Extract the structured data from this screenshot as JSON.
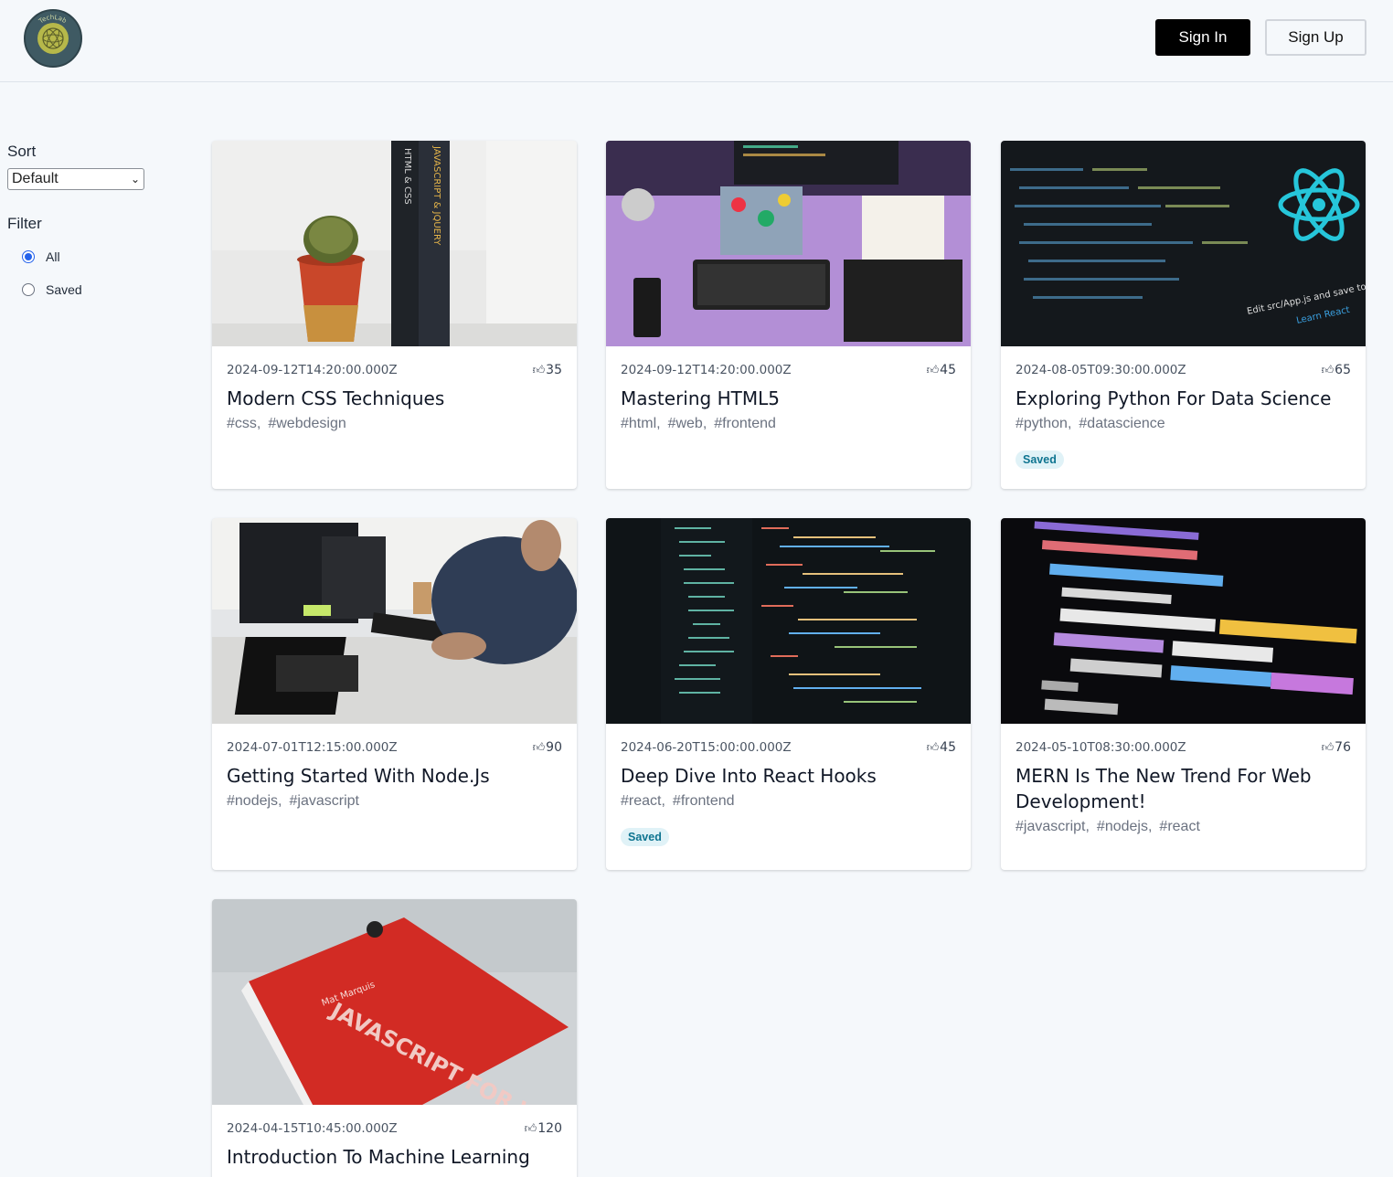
{
  "header": {
    "logo_text": "TechLab",
    "signin_label": "Sign In",
    "signup_label": "Sign Up"
  },
  "sidebar": {
    "sort_heading": "Sort",
    "sort_value": "Default",
    "filter_heading": "Filter",
    "filter_options": [
      {
        "label": "All",
        "checked": true
      },
      {
        "label": "Saved",
        "checked": false
      }
    ]
  },
  "posts": [
    {
      "date": "2024-09-12T14:20:00.000Z",
      "likes": "35",
      "title": "Modern CSS Techniques",
      "tags": [
        "#css,",
        "#webdesign"
      ],
      "saved": false,
      "image": "cactus-books"
    },
    {
      "date": "2024-09-12T14:20:00.000Z",
      "likes": "45",
      "title": "Mastering HTML5",
      "tags": [
        "#html,",
        "#web,",
        "#frontend"
      ],
      "saved": false,
      "image": "desk-setup"
    },
    {
      "date": "2024-08-05T09:30:00.000Z",
      "likes": "65",
      "title": "Exploring Python For Data Science",
      "tags": [
        "#python,",
        "#datascience"
      ],
      "saved": true,
      "image": "react-screen"
    },
    {
      "date": "2024-07-01T12:15:00.000Z",
      "likes": "90",
      "title": "Getting Started With Node.Js",
      "tags": [
        "#nodejs,",
        "#javascript"
      ],
      "saved": false,
      "image": "office-people"
    },
    {
      "date": "2024-06-20T15:00:00.000Z",
      "likes": "45",
      "title": "Deep Dive Into React Hooks",
      "tags": [
        "#react,",
        "#frontend"
      ],
      "saved": true,
      "image": "code-editor"
    },
    {
      "date": "2024-05-10T08:30:00.000Z",
      "likes": "76",
      "title": "MERN Is The New Trend For Web Development!",
      "tags": [
        "#javascript,",
        "#nodejs,",
        "#react"
      ],
      "saved": false,
      "image": "code-colorful"
    },
    {
      "date": "2024-04-15T10:45:00.000Z",
      "likes": "120",
      "title": "Introduction To Machine Learning",
      "tags": [],
      "saved": false,
      "image": "red-book"
    }
  ],
  "saved_badge_label": "Saved",
  "like_icon": "thumbs-up-icon",
  "image_texts": {
    "book_spine_1": "HTML & CSS",
    "book_spine_2": "JAVASCRIPT & JQUERY",
    "react_caption": "Edit src/App.js and save to reload",
    "react_link": "Learn React",
    "red_book_title": "JAVASCRIPT FOR WEB DESIGNERS",
    "red_book_author": "Mat Marquis"
  }
}
